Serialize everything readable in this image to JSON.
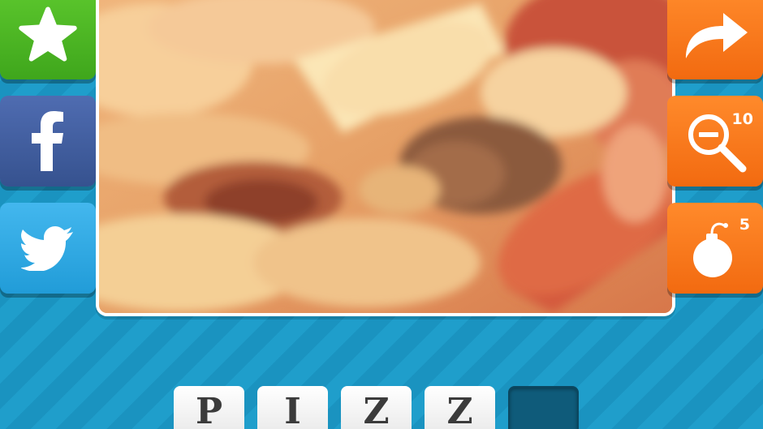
{
  "left_buttons": [
    {
      "name": "favorite",
      "icon": "star-icon",
      "color": "#4cb827"
    },
    {
      "name": "facebook",
      "icon": "facebook-icon",
      "color": "#3f5d9e"
    },
    {
      "name": "twitter",
      "icon": "twitter-bird-icon",
      "color": "#2eaae4"
    }
  ],
  "right_buttons": [
    {
      "name": "share",
      "icon": "curved-arrow-icon",
      "color": "#f5761a"
    },
    {
      "name": "zoom-out-hint",
      "icon": "magnifier-minus-icon",
      "count": "10",
      "color": "#f5761a"
    },
    {
      "name": "bomb-hint",
      "icon": "bomb-icon",
      "count": "5",
      "color": "#f5761a"
    }
  ],
  "answer": {
    "tiles": [
      "P",
      "I",
      "Z",
      "Z",
      ""
    ]
  }
}
